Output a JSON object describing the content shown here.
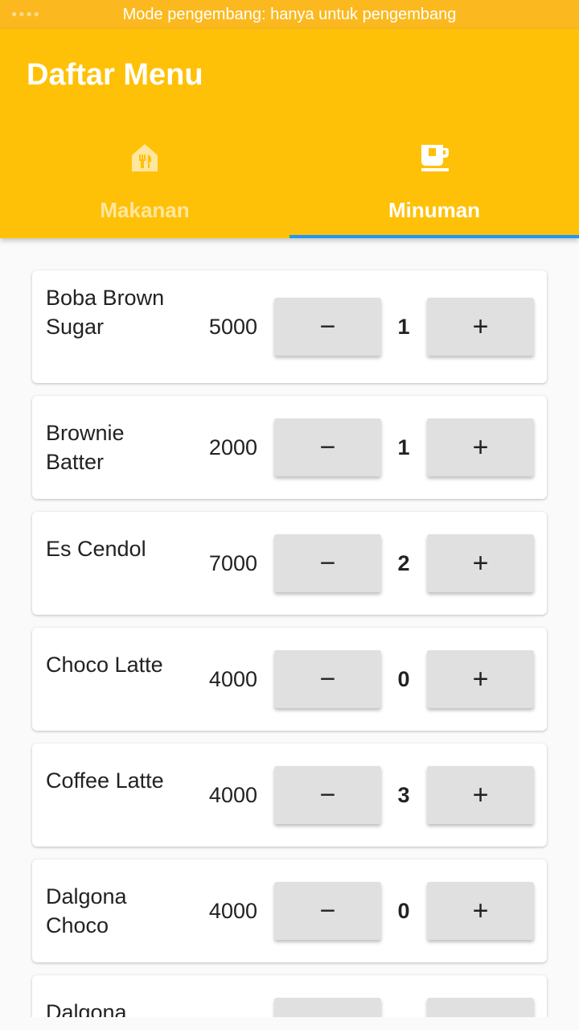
{
  "status_bar": {
    "text": "Mode pengembang: hanya untuk pengembang"
  },
  "app_bar": {
    "title": "Daftar Menu"
  },
  "tabs": [
    {
      "label": "Makanan",
      "icon": "restaurant-icon",
      "selected": false
    },
    {
      "label": "Minuman",
      "icon": "coffee-cup-icon",
      "selected": true
    }
  ],
  "colors": {
    "primary": "#ffc107",
    "indicator": "#2196f3",
    "button": "#e0e0e0"
  },
  "buttons": {
    "minus": "−",
    "plus": "+"
  },
  "items": [
    {
      "name": "Boba Brown Sugar",
      "price": "5000",
      "qty": "1"
    },
    {
      "name": "Brownie Batter",
      "price": "2000",
      "qty": "1"
    },
    {
      "name": "Es Cendol",
      "price": "7000",
      "qty": "2"
    },
    {
      "name": "Choco Latte",
      "price": "4000",
      "qty": "0"
    },
    {
      "name": "Coffee Latte",
      "price": "4000",
      "qty": "3"
    },
    {
      "name": "Dalgona Choco",
      "price": "4000",
      "qty": "0"
    },
    {
      "name": "Dalgona"
    }
  ]
}
